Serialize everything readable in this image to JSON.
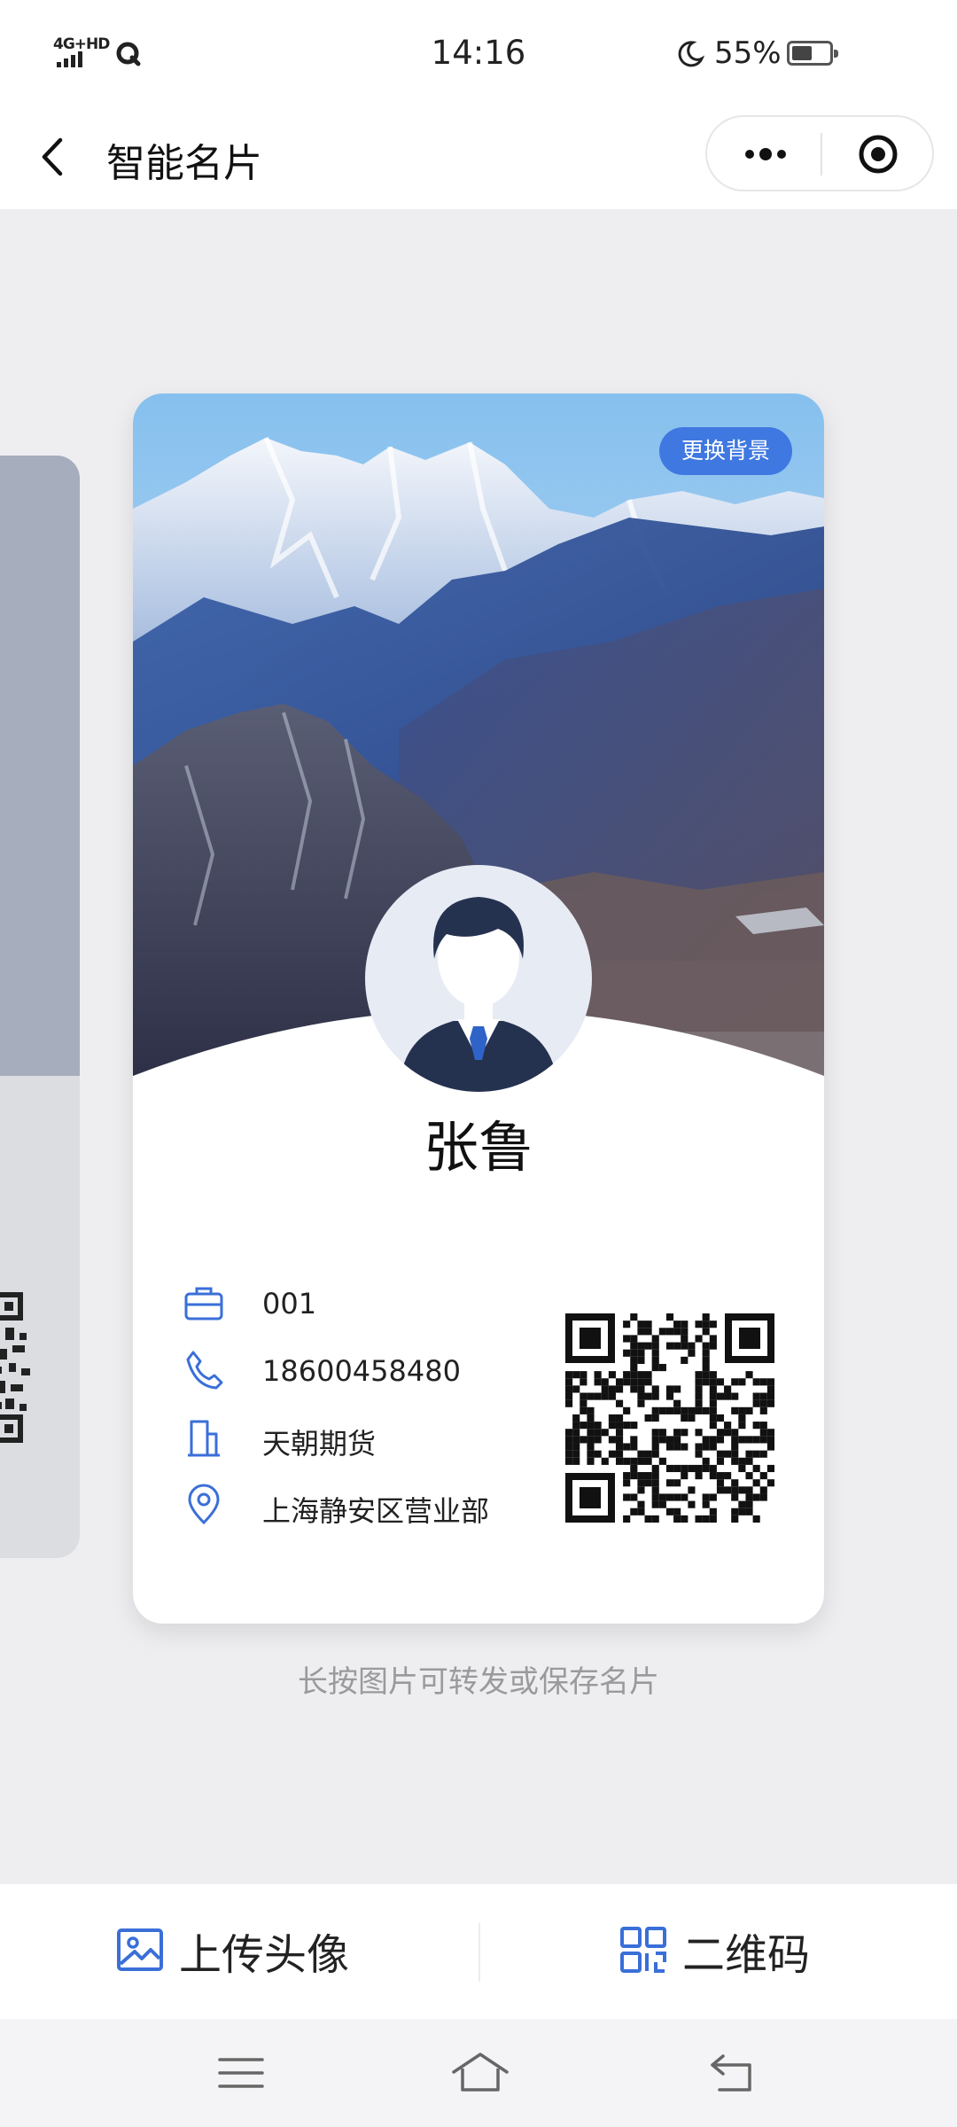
{
  "status_bar": {
    "network": "4G+HD",
    "time": "14:16",
    "battery_percent": "55%",
    "battery_level": 0.55
  },
  "nav": {
    "title": "智能名片"
  },
  "card": {
    "change_background_label": "更换背景",
    "name": "张鲁",
    "employee_id": "001",
    "phone": "18600458480",
    "company": "天朝期货",
    "department": "上海静安区营业部"
  },
  "hint": "长按图片可转发或保存名片",
  "bottom_bar": {
    "upload_avatar_label": "上传头像",
    "qr_code_label": "二维码"
  },
  "colors": {
    "accent": "#3f78e0",
    "icon_blue": "#3a6fd8",
    "hint_gray": "#9a9a9a"
  }
}
